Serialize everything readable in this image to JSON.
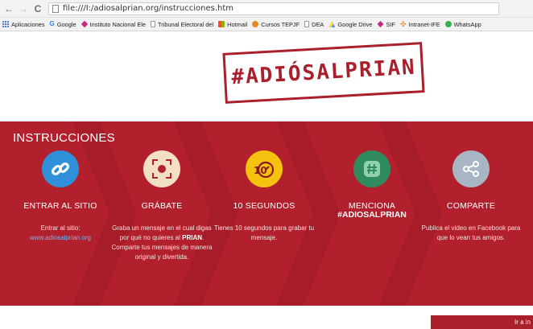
{
  "browser": {
    "url": "file:///I:/adiosalprian.org/instrucciones.htm",
    "bookmarks": [
      {
        "label": "Aplicaciones",
        "icon": "apps-grid-icon"
      },
      {
        "label": "Google",
        "icon": "google-icon"
      },
      {
        "label": "Instituto Nacional Ele",
        "icon": "ine-icon"
      },
      {
        "label": "Tribunal Electoral del",
        "icon": "page-icon"
      },
      {
        "label": "Hotmail",
        "icon": "microsoft-icon"
      },
      {
        "label": "Cursos TEPJF",
        "icon": "tepjf-icon"
      },
      {
        "label": "DEA",
        "icon": "page-icon"
      },
      {
        "label": "Google Drive",
        "icon": "drive-icon"
      },
      {
        "label": "SIF",
        "icon": "ine-icon"
      },
      {
        "label": "Intranet-IFE",
        "icon": "intranet-icon"
      },
      {
        "label": "WhatsApp",
        "icon": "whatsapp-icon"
      }
    ]
  },
  "logo": {
    "text": "#ADIÓSALPRIAN"
  },
  "instructions": {
    "title": "INSTRUCCIONES",
    "steps": [
      {
        "name": "ENTRAR AL SITIO",
        "icon": "link-icon",
        "color": "#2f8fd8",
        "desc_1": "Entrar al sitio:",
        "link": "www.adiosalprian.org"
      },
      {
        "name": "GRÁBATE",
        "icon": "record-icon",
        "color": "#f3dfc5",
        "desc_1": "Graba un mensaje en el cual digas por qué no quieres al",
        "bold": "PRIAN",
        "desc_2": ". Comparte tus mensajes de manera original y divertida."
      },
      {
        "name": "10 SEGUNDOS",
        "icon": "timer-icon",
        "color": "#f4c20f",
        "desc_1": "Tienes 10 segundos para grabar tu mensaje."
      },
      {
        "name": "MENCIONA",
        "sub": "#ADIOSALPRIAN",
        "icon": "hashtag-icon",
        "color": "#2f8a5e",
        "desc_1": ""
      },
      {
        "name": "COMPARTE",
        "icon": "share-icon",
        "color": "#a8b6c4",
        "desc_1": "Publica el video en Facebook para que lo vean tus amigos."
      }
    ]
  },
  "cta": {
    "label": "Ir a in"
  },
  "colors": {
    "brand_red": "#b3202d",
    "logo_red": "#a91f2b"
  }
}
